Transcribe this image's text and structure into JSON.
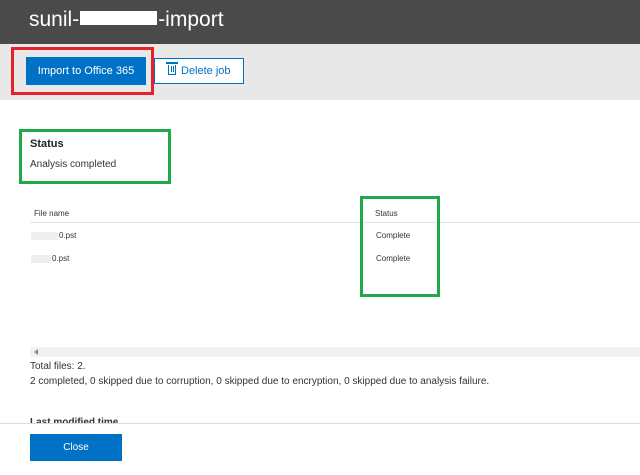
{
  "header": {
    "title_prefix": "sunil-",
    "title_suffix": "-import"
  },
  "toolbar": {
    "import_label": "Import to Office 365",
    "delete_label": "Delete job"
  },
  "status": {
    "heading": "Status",
    "value": "Analysis completed"
  },
  "table": {
    "columns": [
      "File name",
      "Status"
    ],
    "rows": [
      {
        "file": "0.pst",
        "status": "Complete"
      },
      {
        "file": "0.pst",
        "status": "Complete"
      }
    ]
  },
  "summary": {
    "total": "Total files: 2.",
    "detail": "2 completed, 0 skipped due to corruption, 0 skipped due to encryption, 0 skipped due to analysis failure."
  },
  "last_modified_label": "Last modified time",
  "footer": {
    "close_label": "Close"
  },
  "colors": {
    "accent": "#0072c6",
    "highlight_red": "#e8202a",
    "highlight_green": "#22a84a",
    "titlebar": "#4a4a4a"
  }
}
